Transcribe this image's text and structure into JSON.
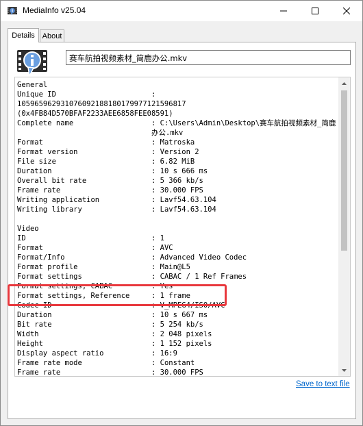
{
  "window": {
    "title": "MediaInfo v25.04"
  },
  "tabs": [
    {
      "label": "Details"
    },
    {
      "label": "About"
    }
  ],
  "filename": "赛车航拍视频素材_简鹿办公.mkv",
  "report": {
    "general_header": "General",
    "unique_id_key": "Unique ID",
    "unique_id_sep": ":",
    "unique_id_line2": "105965962931076092188180179977121596817",
    "unique_id_line3": "(0x4FB84D570BFAF2233AEE6858FEE08591)",
    "general": [
      {
        "k": "Complete name",
        "v": "C:\\Users\\Admin\\Desktop\\赛车航拍视频素材_简鹿办公.mkv"
      },
      {
        "k": "Format",
        "v": "Matroska"
      },
      {
        "k": "Format version",
        "v": "Version 2"
      },
      {
        "k": "File size",
        "v": "6.82 MiB"
      },
      {
        "k": "Duration",
        "v": "10 s 666 ms"
      },
      {
        "k": "Overall bit rate",
        "v": "5 366 kb/s"
      },
      {
        "k": "Frame rate",
        "v": "30.000 FPS"
      },
      {
        "k": "Writing application",
        "v": "Lavf54.63.104"
      },
      {
        "k": "Writing library",
        "v": "Lavf54.63.104"
      }
    ],
    "video_header": "Video",
    "video": [
      {
        "k": "ID",
        "v": "1"
      },
      {
        "k": "Format",
        "v": "AVC"
      },
      {
        "k": "Format/Info",
        "v": "Advanced Video Codec"
      },
      {
        "k": "Format profile",
        "v": "Main@L5"
      },
      {
        "k": "Format settings",
        "v": "CABAC / 1 Ref Frames"
      },
      {
        "k": "Format settings, CABAC",
        "v": "Yes"
      },
      {
        "k": "Format settings, Reference",
        "v": "1 frame"
      },
      {
        "k": "Codec ID",
        "v": "V_MPEG4/ISO/AVC"
      },
      {
        "k": "Duration",
        "v": "10 s 667 ms"
      },
      {
        "k": "Bit rate",
        "v": "5 254 kb/s"
      },
      {
        "k": "Width",
        "v": "2 048 pixels"
      },
      {
        "k": "Height",
        "v": "1 152 pixels"
      },
      {
        "k": "Display aspect ratio",
        "v": "16:9"
      },
      {
        "k": "Frame rate mode",
        "v": "Constant"
      },
      {
        "k": "Frame rate",
        "v": "30.000 FPS"
      }
    ]
  },
  "save_link": "Save to text file",
  "colors": {
    "highlight": "#e8383d",
    "link": "#0066cc"
  }
}
